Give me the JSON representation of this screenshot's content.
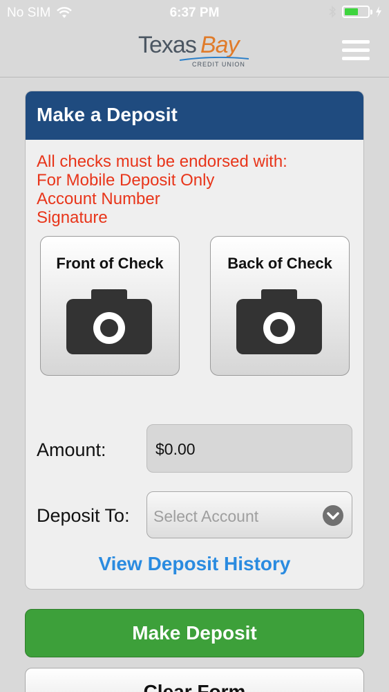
{
  "status_bar": {
    "carrier": "No SIM",
    "time": "6:37 PM",
    "battery_level": 0.6,
    "battery_color": "#3ed43e",
    "icons": [
      "wifi-icon",
      "bluetooth-icon",
      "battery-icon",
      "charging-bolt-icon"
    ]
  },
  "header": {
    "logo_text_1": "Texas",
    "logo_text_2": "Bay",
    "logo_subtext": "CREDIT UNION",
    "menu_icon": "hamburger-menu-icon"
  },
  "card": {
    "title": "Make a Deposit",
    "notice_lines": [
      "All checks must be endorsed with:",
      "For Mobile Deposit Only",
      "Account Number",
      "Signature"
    ],
    "front_check_label": "Front of Check",
    "back_check_label": "Back of Check",
    "camera_icon": "camera-icon",
    "amount_label": "Amount:",
    "amount_value": "$0.00",
    "deposit_to_label": "Deposit To:",
    "deposit_to_placeholder": "Select Account",
    "view_history_label": "View Deposit History"
  },
  "actions": {
    "make_deposit_label": "Make Deposit",
    "clear_form_label": "Clear Form"
  },
  "colors": {
    "header_blue": "#1f4b7f",
    "notice_red": "#e8351a",
    "link_blue": "#2a8be0",
    "deposit_green": "#3da03a",
    "logo_orange": "#e07b2a"
  }
}
